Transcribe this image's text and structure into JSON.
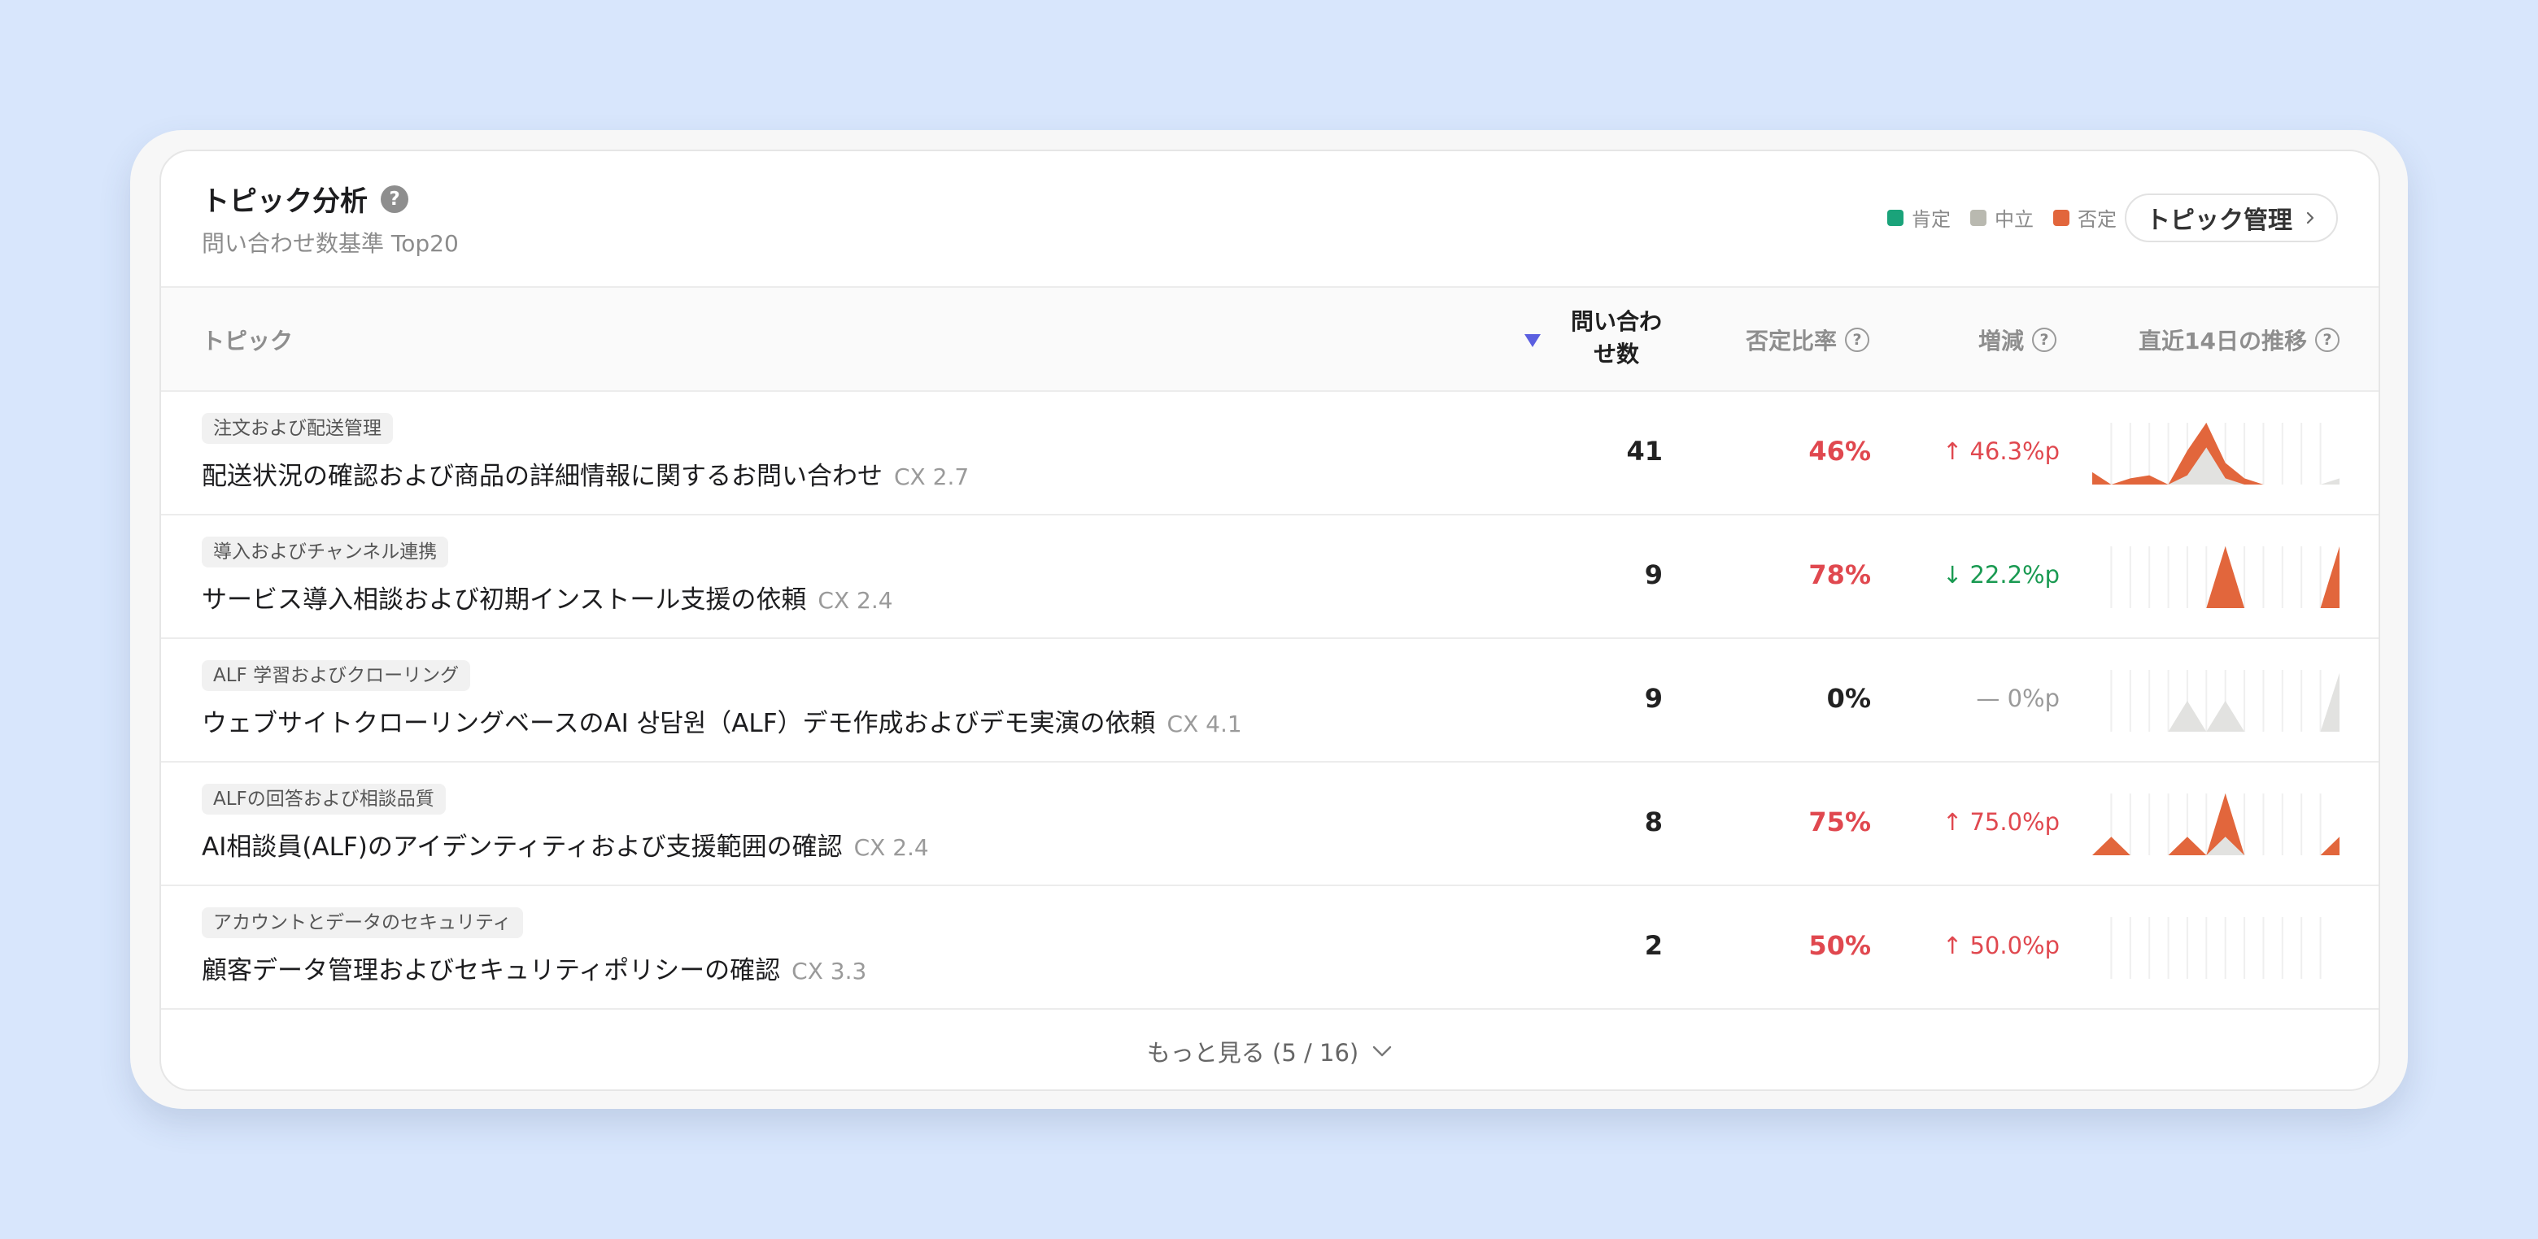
{
  "header": {
    "title": "トピック分析",
    "subtitle": "問い合わせ数基準 Top20",
    "help_glyph": "?",
    "legend": [
      {
        "label": "肯定",
        "color": "#1aa37a"
      },
      {
        "label": "中立",
        "color": "#b9b9b0"
      },
      {
        "label": "否定",
        "color": "#e2663c"
      }
    ],
    "manage_button": "トピック管理"
  },
  "columns": {
    "topic": "トピック",
    "count": "問い合わせ数",
    "negative_ratio": "否定比率",
    "change": "増減",
    "trend": "直近14日の推移",
    "help_glyph": "?"
  },
  "rows": [
    {
      "tag": "注文および配送管理",
      "title": "配送状況の確認および商品の詳細情報に関するお問い合わせ",
      "cx": "CX 2.7",
      "count": "41",
      "negative_ratio": "46%",
      "change": "↑ 46.3%p",
      "change_dir": "up",
      "trend": {
        "negative": [
          0.2,
          0,
          0.1,
          0.15,
          0,
          0.55,
          1.0,
          0.35,
          0.1,
          0,
          0,
          0,
          0,
          0
        ],
        "neutral": [
          0,
          0,
          0,
          0,
          0,
          0.15,
          0.6,
          0.1,
          0,
          0,
          0,
          0,
          0,
          0.1
        ]
      }
    },
    {
      "tag": "導入およびチャンネル連携",
      "title": "サービス導入相談および初期インストール支援の依頼",
      "cx": "CX 2.4",
      "count": "9",
      "negative_ratio": "78%",
      "change": "↓ 22.2%p",
      "change_dir": "down",
      "trend": {
        "negative": [
          0,
          0,
          0,
          0,
          0,
          0,
          0,
          1.0,
          0,
          0,
          0,
          0,
          0,
          1.0
        ],
        "neutral": [
          0,
          0,
          0,
          0,
          0,
          0,
          0,
          0,
          0,
          0,
          0,
          0,
          0,
          0
        ]
      }
    },
    {
      "tag": "ALF 学習およびクローリング",
      "title": "ウェブサイトクローリングベースのAI 상담원（ALF）デモ作成およびデモ実演の依頼",
      "cx": "CX 4.1",
      "count": "9",
      "negative_ratio": "0%",
      "change": "— 0%p",
      "change_dir": "flat",
      "trend": {
        "negative": [
          0,
          0,
          0,
          0,
          0,
          0,
          0,
          0,
          0,
          0,
          0,
          0,
          0,
          0
        ],
        "neutral": [
          0,
          0,
          0,
          0,
          0,
          0.5,
          0,
          0.5,
          0,
          0,
          0,
          0,
          0,
          0.95
        ]
      }
    },
    {
      "tag": "ALFの回答および相談品質",
      "title": "AI相談員(ALF)のアイデンティティおよび支援範囲の確認",
      "cx": "CX 2.4",
      "count": "8",
      "negative_ratio": "75%",
      "change": "↑ 75.0%p",
      "change_dir": "up",
      "trend": {
        "negative": [
          0,
          0.3,
          0,
          0,
          0,
          0.3,
          0,
          1.0,
          0,
          0,
          0,
          0,
          0,
          0.3
        ],
        "neutral": [
          0,
          0,
          0,
          0,
          0,
          0,
          0,
          0.3,
          0,
          0,
          0,
          0,
          0,
          0
        ]
      }
    },
    {
      "tag": "アカウントとデータのセキュリティ",
      "title": "顧客データ管理およびセキュリティポリシーの確認",
      "cx": "CX 3.3",
      "count": "2",
      "negative_ratio": "50%",
      "change": "↑ 50.0%p",
      "change_dir": "up",
      "trend": {
        "negative": [
          0,
          0,
          0,
          0,
          0,
          0,
          0,
          0,
          0,
          0,
          0,
          0,
          0,
          0
        ],
        "neutral": [
          0,
          0,
          0,
          0,
          0,
          0,
          0,
          0,
          0,
          0,
          0,
          0,
          0,
          0
        ]
      }
    }
  ],
  "footer": {
    "more_label": "もっと見る (5 / 16)"
  },
  "colors": {
    "negative_text": "#e0484f",
    "up": "#e0484f",
    "down": "#1a9a52",
    "flat": "#9a9a9a",
    "accent": "#5b5fe0",
    "neg_fill": "#e2663c",
    "neutral_fill": "#e2e2e0"
  }
}
